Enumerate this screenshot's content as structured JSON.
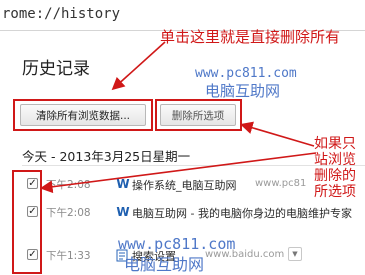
{
  "address_bar": {
    "url": "rome://history"
  },
  "page": {
    "title": "历史记录"
  },
  "buttons": {
    "clear_all_label": "清除所有浏览数据...",
    "delete_selected_label": "删除所选项"
  },
  "day_header": "今天 - 2013年3月25日星期一",
  "entries": [
    {
      "checked": true,
      "time": "下午2:08",
      "title": "操作系统_电脑互助网",
      "domain": "www.pc81",
      "favicon": "w-logo-icon"
    },
    {
      "checked": true,
      "time": "下午2:08",
      "title": "电脑互助网 - 我的电脑你身边的电脑维护专家",
      "domain": "",
      "favicon": "w-logo-icon"
    },
    {
      "checked": true,
      "time": "下午1:33",
      "title": "搜索设置",
      "domain": "www.baidu.com",
      "favicon": "search-icon"
    }
  ],
  "annotations": {
    "top": "单击这里就是直接删除所有",
    "side_lines": [
      "如果只",
      "站浏览",
      "删除的",
      "所选项"
    ]
  },
  "watermarks": {
    "url": "www.pc811.com",
    "name": "电脑互助网"
  },
  "colors": {
    "annotation": "#d01818",
    "watermark": "#4f78c8",
    "favicon": "#1e5fb0"
  }
}
